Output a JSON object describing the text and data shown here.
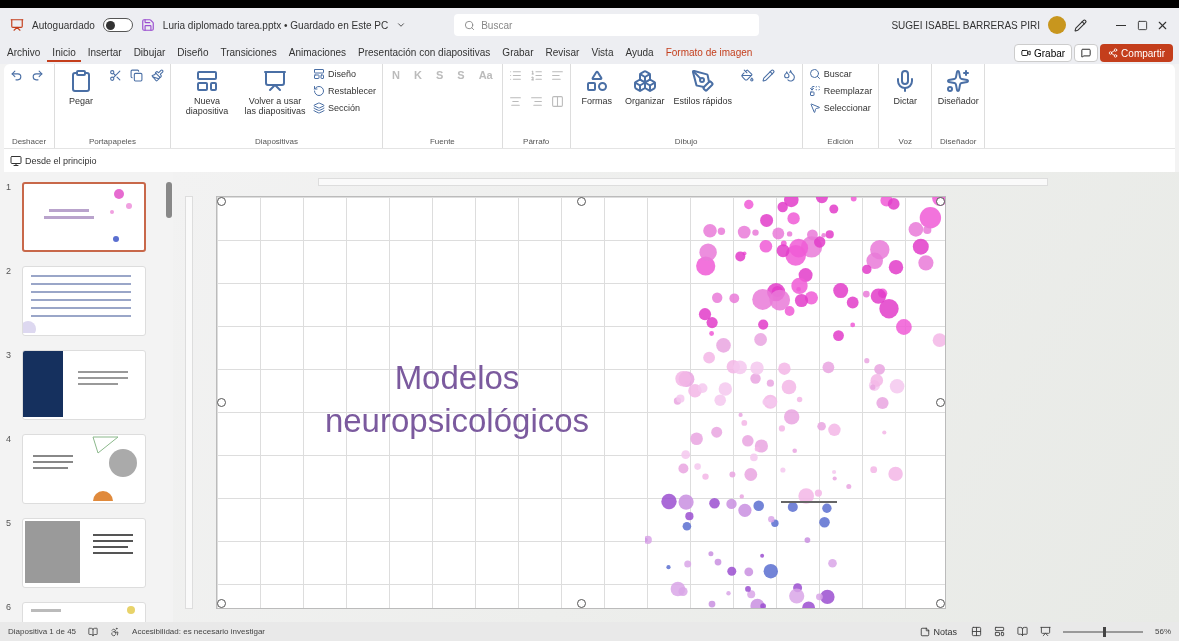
{
  "titlebar": {
    "autosave_label": "Autoguardado",
    "autosave_on": false,
    "filename": "Luria diplomado tarea.pptx • Guardado en Este PC",
    "search": {
      "placeholder": "Buscar"
    },
    "user": "SUGEI ISABEL BARRERAS PIRI"
  },
  "tabs": [
    {
      "label": "Archivo",
      "selected": false,
      "kind": "normal"
    },
    {
      "label": "Inicio",
      "selected": true,
      "kind": "normal"
    },
    {
      "label": "Insertar",
      "selected": false,
      "kind": "normal"
    },
    {
      "label": "Dibujar",
      "selected": false,
      "kind": "normal"
    },
    {
      "label": "Diseño",
      "selected": false,
      "kind": "normal"
    },
    {
      "label": "Transiciones",
      "selected": false,
      "kind": "normal"
    },
    {
      "label": "Animaciones",
      "selected": false,
      "kind": "normal"
    },
    {
      "label": "Presentación con diapositivas",
      "selected": false,
      "kind": "normal"
    },
    {
      "label": "Grabar",
      "selected": false,
      "kind": "normal"
    },
    {
      "label": "Revisar",
      "selected": false,
      "kind": "normal"
    },
    {
      "label": "Vista",
      "selected": false,
      "kind": "normal"
    },
    {
      "label": "Ayuda",
      "selected": false,
      "kind": "normal"
    },
    {
      "label": "Formato de imagen",
      "selected": false,
      "kind": "contextual"
    }
  ],
  "record_button": "Grabar",
  "share_button": "Compartir",
  "ribbon": [
    {
      "label": "Deshacer",
      "items": [
        {
          "kind": "icon"
        },
        {
          "kind": "icon"
        }
      ]
    },
    {
      "label": "Portapapeles",
      "items": [
        {
          "kind": "large",
          "label": "Pegar"
        },
        {
          "kind": "icon"
        },
        {
          "kind": "icon"
        },
        {
          "kind": "icon"
        }
      ]
    },
    {
      "label": "Diapositivas",
      "items": [
        {
          "kind": "large",
          "label": "Nueva diapositiva"
        },
        {
          "kind": "large",
          "label": "Volver a usar las diapositivas"
        },
        {
          "kind": "small",
          "label": "Diseño"
        },
        {
          "kind": "small",
          "label": "Restablecer"
        },
        {
          "kind": "small",
          "label": "Sección"
        }
      ]
    },
    {
      "label": "Fuente",
      "disabled": true,
      "items": [
        {
          "kind": "letter",
          "label": "N"
        },
        {
          "kind": "letter",
          "label": "K"
        },
        {
          "kind": "letter",
          "label": "S"
        },
        {
          "kind": "letter",
          "label": "S"
        },
        {
          "kind": "letter",
          "label": "Aa"
        }
      ]
    },
    {
      "label": "Párrafo",
      "disabled": true,
      "items": [
        {
          "kind": "icon"
        },
        {
          "kind": "icon"
        },
        {
          "kind": "icon"
        },
        {
          "kind": "icon"
        },
        {
          "kind": "icon"
        },
        {
          "kind": "icon"
        }
      ]
    },
    {
      "label": "Dibujo",
      "items": [
        {
          "kind": "large",
          "label": "Formas"
        },
        {
          "kind": "large",
          "label": "Organizar"
        },
        {
          "kind": "large",
          "label": "Estilos rápidos"
        },
        {
          "kind": "icon"
        },
        {
          "kind": "icon"
        },
        {
          "kind": "icon"
        }
      ]
    },
    {
      "label": "Edición",
      "items": [
        {
          "kind": "small",
          "label": "Buscar"
        },
        {
          "kind": "small",
          "label": "Reemplazar"
        },
        {
          "kind": "small",
          "label": "Seleccionar"
        }
      ]
    },
    {
      "label": "Voz",
      "items": [
        {
          "kind": "large",
          "label": "Dictar"
        }
      ]
    },
    {
      "label": "Diseñador",
      "items": [
        {
          "kind": "large",
          "label": "Diseñador"
        }
      ]
    }
  ],
  "quick_bar": {
    "label": "Desde el principio"
  },
  "thumbnails": [
    {
      "number": "1",
      "selected": true,
      "kind": "title"
    },
    {
      "number": "2",
      "selected": false,
      "kind": "list"
    },
    {
      "number": "3",
      "selected": false,
      "kind": "dark"
    },
    {
      "number": "4",
      "selected": false,
      "kind": "art"
    },
    {
      "number": "5",
      "selected": false,
      "kind": "portrait"
    },
    {
      "number": "6",
      "selected": false,
      "kind": "partial"
    }
  ],
  "slide": {
    "title": "Modelos neuropsicológicos"
  },
  "status_bar": {
    "slide_count": "Diapositiva 1 de 45",
    "accessibility": "Accesibilidad: es necesario investigar",
    "notes": "Notas",
    "zoom": "56%",
    "zoom_slider": {
      "level": 0.5
    }
  }
}
